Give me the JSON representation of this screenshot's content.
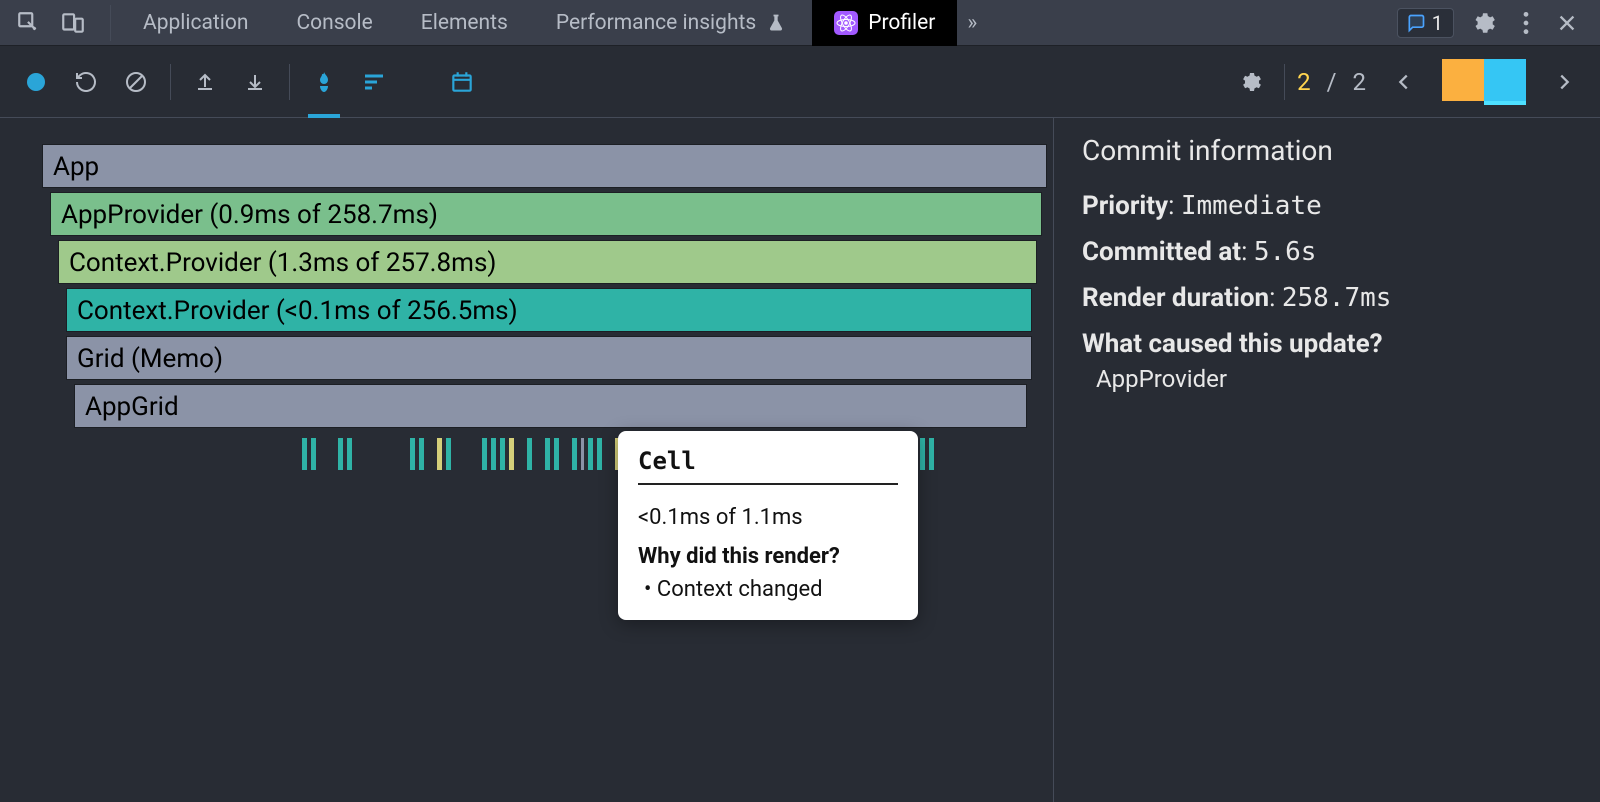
{
  "tabs": {
    "application": "Application",
    "console": "Console",
    "elements": "Elements",
    "perf_insights": "Performance insights",
    "profiler": "Profiler",
    "overflow": "»"
  },
  "issues": {
    "count": "1"
  },
  "toolbar": {
    "commit_current": "2",
    "commit_sep": "/",
    "commit_total": "2"
  },
  "flame": {
    "rows": [
      {
        "label": "App",
        "tone": "gray",
        "indent": 0,
        "widthPct": 100
      },
      {
        "label": "AppProvider (0.9ms of 258.7ms)",
        "tone": "green1",
        "indent": 1,
        "widthPct": 99.5
      },
      {
        "label": "Context.Provider (1.3ms of 257.8ms)",
        "tone": "green2",
        "indent": 2,
        "widthPct": 99.0
      },
      {
        "label": "Context.Provider (<0.1ms of 256.5ms)",
        "tone": "teal",
        "indent": 3,
        "widthPct": 98.5
      },
      {
        "label": "Grid (Memo)",
        "tone": "gray",
        "indent": 3,
        "widthPct": 98.5
      },
      {
        "label": "AppGrid",
        "tone": "gray",
        "indent": 4,
        "widthPct": 98.0
      }
    ]
  },
  "tooltip": {
    "title": "Cell",
    "duration": "<0.1ms of 1.1ms",
    "why_heading": "Why did this render?",
    "reasons": [
      "Context changed"
    ]
  },
  "side": {
    "title": "Commit information",
    "priority_label": "Priority",
    "priority_value": "Immediate",
    "committed_label": "Committed at",
    "committed_value": "5.6s",
    "render_label": "Render duration",
    "render_value": "258.7ms",
    "cause_label": "What caused this update?",
    "causes": [
      "AppProvider"
    ]
  }
}
